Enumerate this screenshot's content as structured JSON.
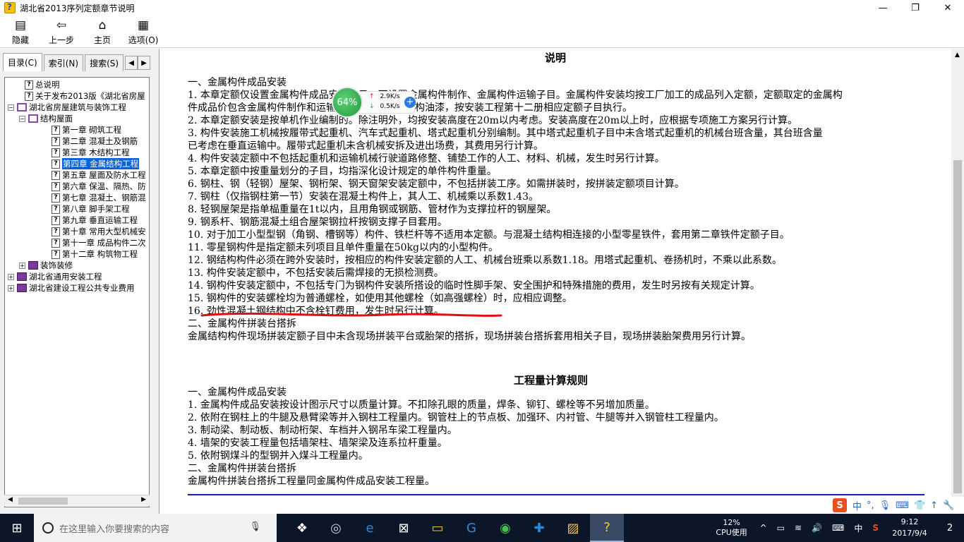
{
  "window": {
    "title": "湖北省2013序列定额章节说明",
    "min_icon": "—",
    "max_icon": "❐",
    "close_icon": "✕"
  },
  "toolbar": {
    "buttons": [
      {
        "icon": "▤",
        "label": "隐藏"
      },
      {
        "icon": "⇦",
        "label": "上一步"
      },
      {
        "icon": "⌂",
        "label": "主页"
      },
      {
        "icon": "▦",
        "label": "选项(O)"
      }
    ]
  },
  "left_pane": {
    "tabs": [
      "目录(C)",
      "索引(N)",
      "搜索(S)"
    ],
    "tab_prev": "◀",
    "tab_next": "▶",
    "tree": [
      {
        "type": "doc",
        "label": "总说明"
      },
      {
        "type": "doc",
        "label": "关于发布2013版《湖北省房屋"
      },
      {
        "type": "book-open",
        "label": "湖北省房屋建筑与装饰工程",
        "expander": "−"
      },
      {
        "type": "book-open",
        "label": "结构屋面",
        "expander": "−"
      },
      {
        "type": "doc",
        "label": "第一章  砌筑工程"
      },
      {
        "type": "doc",
        "label": "第二章  混凝土及钢筋"
      },
      {
        "type": "doc",
        "label": "第三章  木结构工程"
      },
      {
        "type": "doc",
        "label": "第四章  金属结构工程",
        "selected": true
      },
      {
        "type": "doc",
        "label": "第五章  屋面及防水工程"
      },
      {
        "type": "doc",
        "label": "第六章  保温、隔热、防"
      },
      {
        "type": "doc",
        "label": "第七章  混凝土、钢筋混"
      },
      {
        "type": "doc",
        "label": "第八章  脚手架工程"
      },
      {
        "type": "doc",
        "label": "第九章  垂直运输工程"
      },
      {
        "type": "doc",
        "label": "第十章  常用大型机械安"
      },
      {
        "type": "doc",
        "label": "第十一章  成品构件二次"
      },
      {
        "type": "doc",
        "label": "第十二章  构筑物工程"
      },
      {
        "type": "book",
        "label": "装饰装修",
        "expander": "+"
      },
      {
        "type": "book",
        "label": "湖北省通用安装工程",
        "expander": "+"
      },
      {
        "type": "book",
        "label": "湖北省建设工程公共专业费用",
        "expander": "+"
      }
    ],
    "hscroll_left": "◀",
    "hscroll_right": "▶"
  },
  "content": {
    "title": "说明",
    "lines": [
      "一、金属构件成品安装",
      "1. 本章定额仅设置金属构件成品安装子目，不设置金属构件制作、金属构件运输子目。金属构件安装均按工厂加工的成品列入定额，定额取定的金属构",
      "件成品价包含金属构件制作和运输费用，涂刷金属结构油漆，按安装工程第十二册相应定额子目执行。",
      "2. 本章定额安装是按单机作业编制的。除注明外，均按安装高度在20m以内考虑。安装高度在20m以上时，应根据专项施工方案另行计算。",
      "3. 构件安装施工机械按履带式起重机、汽车式起重机、塔式起重机分别编制。其中塔式起重机子目中未含塔式起重机的机械台班含量，其台班含量",
      "已考虑在垂直运输中。履带式起重机未含机械安拆及进出场费，其费用另行计算。",
      "4. 构件安装定额中不包括起重机和运输机械行驶道路修整、铺垫工作的人工、材料、机械，发生时另行计算。",
      "5. 本章定额中按重量划分的子目，均指深化设计规定的单件构件重量。",
      "6. 钢柱、钢（轻钢）屋架、钢桁架、钢天窗架安装定额中，不包括拼装工序。如需拼装时，按拼装定额项目计算。",
      "7. 钢柱（仅指钢柱第一节）安装在混凝土构件上，其人工、机械乘以系数1.43。",
      "8. 轻钢屋架是指单榀重量在1t以内，且用角钢或钢筋、管材作为支撑拉杆的钢屋架。",
      "9. 钢系杆、钢筋混凝土组合屋架钢拉杆按钢支撑子目套用。",
      "10. 对于加工小型型钢（角钢、槽钢等）构件、铁栏杆等不适用本定额。与混凝土结构相连接的小型零星铁件，套用第二章铁件定额子目。",
      "11. 零星钢构件是指定额未列项目且单件重量在50kg以内的小型构件。",
      "12. 钢结构构件必须在跨外安装时，按相应的构件安装定额的人工、机械台班乘以系数1.18。用塔式起重机、卷扬机时，不乘以此系数。",
      "13. 构件安装定额中，不包括安装后需焊接的无损检测费。",
      "14. 钢构件安装定额中，不包括专门为钢构件安装所搭设的临时性脚手架、安全围护和特殊措施的费用，发生时另按有关规定计算。",
      "15. 钢构件的安装螺栓均为普通螺栓，如使用其他螺栓（如高强螺栓）时，应相应调整。",
      "16. 劲性混凝土钢结构中不含栓钉费用，发生时另行计算。",
      "二、金属构件拼装台搭拆",
      "金属结构构件现场拼装定额子目中未含现场拼装平台或胎架的搭拆，现场拼装台搭拆套用相关子目，现场拼装胎架费用另行计算。"
    ],
    "title2": "工程量计算规则",
    "lines2": [
      "一、金属构件成品安装",
      "1. 金属构件成品安装按设计图示尺寸以质量计算。不扣除孔眼的质量，焊条、铆钉、螺栓等不另增加质量。",
      "2. 依附在钢柱上的牛腿及悬臂梁等并入钢柱工程量内。钢管柱上的节点板、加强环、内衬管、牛腿等并入钢管柱工程量内。",
      "3. 制动梁、制动板、制动桁架、车档并入钢吊车梁工程量内。",
      "4. 墙架的安装工程量包括墙架柱、墙架梁及连系拉杆重量。",
      "5. 依附钢煤斗的型钢并入煤斗工程量内。",
      "二、金属构件拼装台搭拆",
      "金属构件拼装台搭拆工程量同金属构件成品安装工程量。"
    ]
  },
  "speed_widget": {
    "percent": "64%",
    "up": "2.9K/s",
    "down": "0.5K/s",
    "up_arrow": "↑",
    "down_arrow": "↓",
    "plus": "+"
  },
  "ime": {
    "logo": "S",
    "items": [
      "中",
      "°,",
      "🎙",
      "⌨",
      "👕",
      "↑",
      "🔧"
    ]
  },
  "taskbar": {
    "start_icon": "⊞",
    "search_placeholder": "在这里输入你要搜索的内容",
    "mic_icon": "🎙",
    "apps": [
      {
        "icon": "❖",
        "name": "task-view"
      },
      {
        "icon": "◎",
        "name": "app-swirl"
      },
      {
        "icon": "e",
        "name": "edge"
      },
      {
        "icon": "⊠",
        "name": "store"
      },
      {
        "icon": "▭",
        "name": "file-explorer"
      },
      {
        "icon": "G",
        "name": "app-g"
      },
      {
        "icon": "◉",
        "name": "app-green"
      },
      {
        "icon": "✚",
        "name": "app-blue-plus"
      },
      {
        "icon": "▨",
        "name": "app-notes"
      },
      {
        "icon": "?",
        "name": "help-app",
        "active": true
      }
    ],
    "cpu_value": "12%",
    "cpu_label": "CPU使用",
    "tray_icons": [
      "^",
      "▭",
      "≋",
      "🔊",
      "⌨"
    ],
    "lang": "中",
    "tray_s": "S",
    "time": "9:12",
    "date": "2017/9/4",
    "notif": "2"
  },
  "colors": {
    "selection": "#0a64d8",
    "red_underline": "#e01010",
    "blue_rule": "#1a1ab0",
    "taskbar": "#0b1629"
  }
}
